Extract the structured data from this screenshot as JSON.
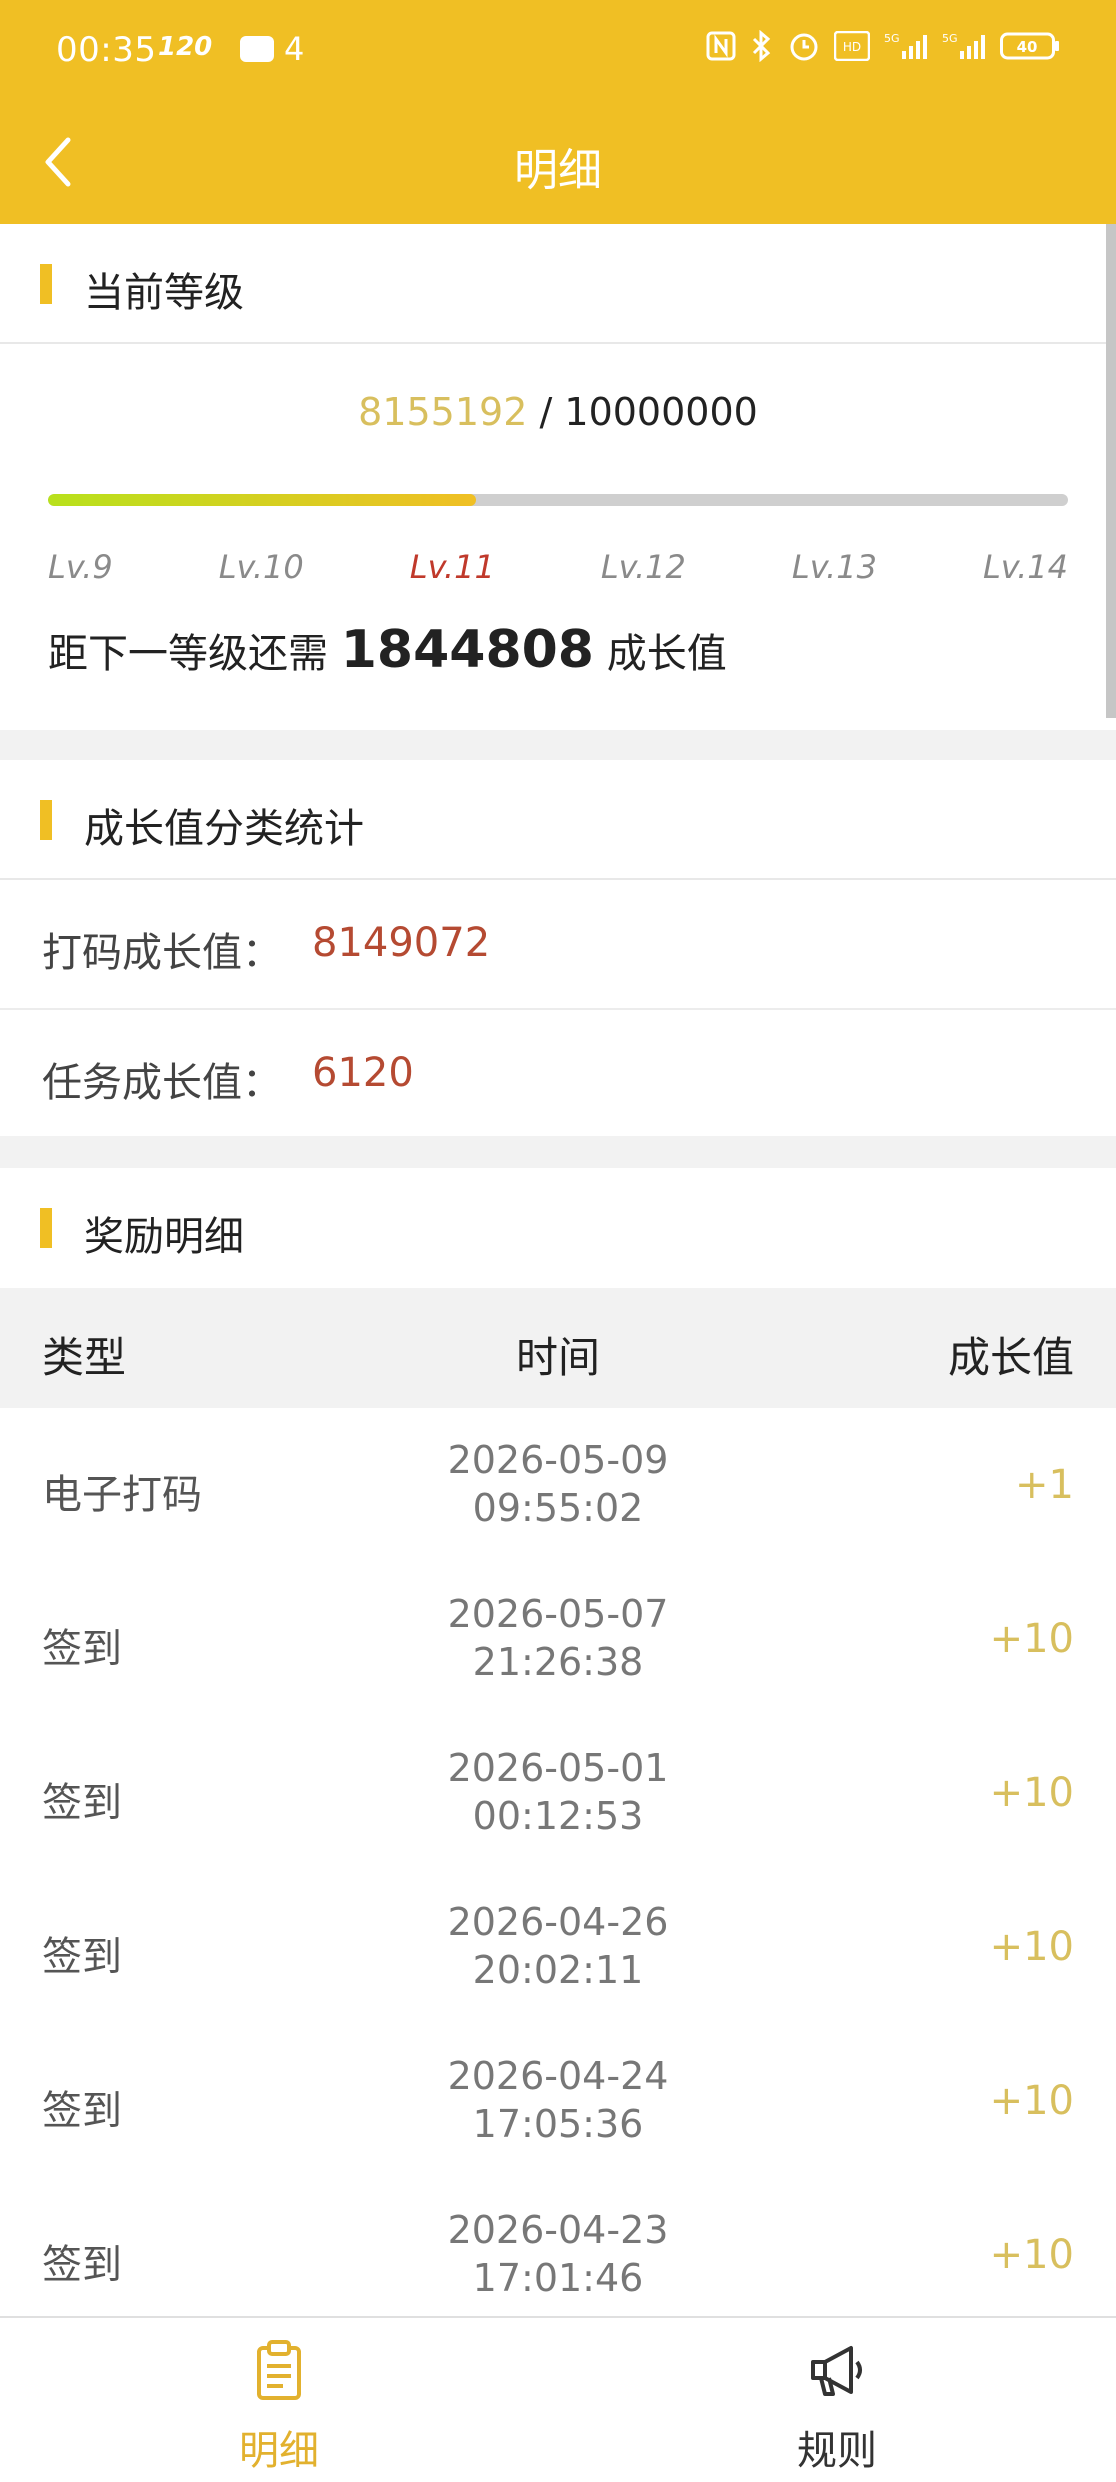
{
  "status_bar": {
    "time": "00:35",
    "refresh": "120",
    "notification_count": "4",
    "battery": "40"
  },
  "header": {
    "title": "明细"
  },
  "level": {
    "section_title": "当前等级",
    "current_value": "8155192",
    "separator": "/",
    "target_value": "10000000",
    "progress_fraction": 0.42,
    "levels": [
      "Lv.9",
      "Lv.10",
      "Lv.11",
      "Lv.12",
      "Lv.13",
      "Lv.14"
    ],
    "active_level": "Lv.11",
    "need_prefix": "距下一等级还需",
    "need_value": "1844808",
    "need_suffix": "成长值"
  },
  "stats": {
    "section_title": "成长值分类统计",
    "items": [
      {
        "label": "打码成长值：",
        "value": "8149072"
      },
      {
        "label": "任务成长值：",
        "value": "6120"
      }
    ]
  },
  "rewards": {
    "section_title": "奖励明细",
    "columns": [
      "类型",
      "时间",
      "成长值"
    ],
    "rows": [
      {
        "type": "电子打码",
        "date": "2026-05-09",
        "time": "09:55:02",
        "value": "+1"
      },
      {
        "type": "签到",
        "date": "2026-05-07",
        "time": "21:26:38",
        "value": "+10"
      },
      {
        "type": "签到",
        "date": "2026-05-01",
        "time": "00:12:53",
        "value": "+10"
      },
      {
        "type": "签到",
        "date": "2026-04-26",
        "time": "20:02:11",
        "value": "+10"
      },
      {
        "type": "签到",
        "date": "2026-04-24",
        "time": "17:05:36",
        "value": "+10"
      },
      {
        "type": "签到",
        "date": "2026-04-23",
        "time": "17:01:46",
        "value": "+10"
      }
    ]
  },
  "tabs": [
    {
      "label": "明细",
      "icon": "clipboard-icon",
      "active": true
    },
    {
      "label": "规则",
      "icon": "megaphone-icon",
      "active": false
    }
  ],
  "colors": {
    "brand": "#f0bf24",
    "value_red": "#b54a32",
    "value_gold": "#d8bf5e",
    "active_tab": "#e2b12e"
  }
}
